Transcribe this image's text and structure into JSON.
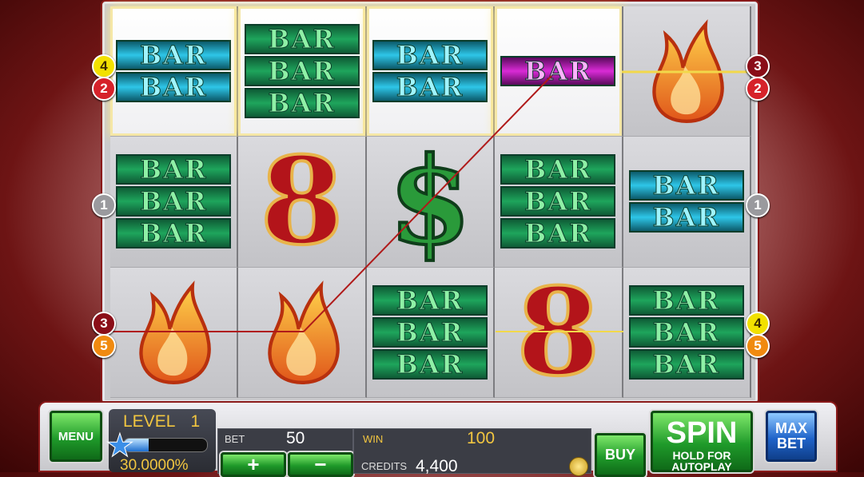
{
  "reels": {
    "grid": [
      [
        {
          "symbol": "bar2",
          "color": "cyan",
          "win": true
        },
        {
          "symbol": "bar3",
          "color": "green",
          "win": true
        },
        {
          "symbol": "bar2",
          "color": "cyan",
          "win": true
        },
        {
          "symbol": "bar1",
          "color": "magenta",
          "win": true
        },
        {
          "symbol": "flame",
          "win": false
        }
      ],
      [
        {
          "symbol": "bar3",
          "color": "green",
          "win": false
        },
        {
          "symbol": "eight",
          "win": false
        },
        {
          "symbol": "dollar",
          "win": false
        },
        {
          "symbol": "bar3",
          "color": "green",
          "win": false
        },
        {
          "symbol": "bar2",
          "color": "cyan",
          "win": false
        }
      ],
      [
        {
          "symbol": "flame",
          "win": false
        },
        {
          "symbol": "flame",
          "win": false
        },
        {
          "symbol": "bar3",
          "color": "green",
          "win": false
        },
        {
          "symbol": "eight",
          "win": false
        },
        {
          "symbol": "bar3",
          "color": "green",
          "win": false
        }
      ]
    ],
    "bar_text": "BAR",
    "eight_text": "8",
    "dollar_text": "$"
  },
  "paylines": {
    "left": [
      "4",
      "2",
      "1",
      "3",
      "5"
    ],
    "right": [
      "3",
      "2",
      "1",
      "4",
      "5"
    ]
  },
  "controls": {
    "menu_label": "MENU",
    "level_label": "LEVEL",
    "level_value": "1",
    "level_progress_text": "30.0000%",
    "level_progress": 0.3,
    "bet_label": "BET",
    "bet_value": "50",
    "plus_label": "+",
    "minus_label": "−",
    "win_label": "WIN",
    "win_value": "100",
    "credits_label": "CREDITS",
    "credits_value": "4,400",
    "buy_label": "BUY",
    "spin_label": "SPIN",
    "spin_sub": "HOLD FOR AUTOPLAY",
    "maxbet_label": "MAX BET"
  },
  "colors": {
    "accent_gold": "#f2c640",
    "spin_green": "#1f9a2a",
    "max_blue": "#1f63c9"
  }
}
